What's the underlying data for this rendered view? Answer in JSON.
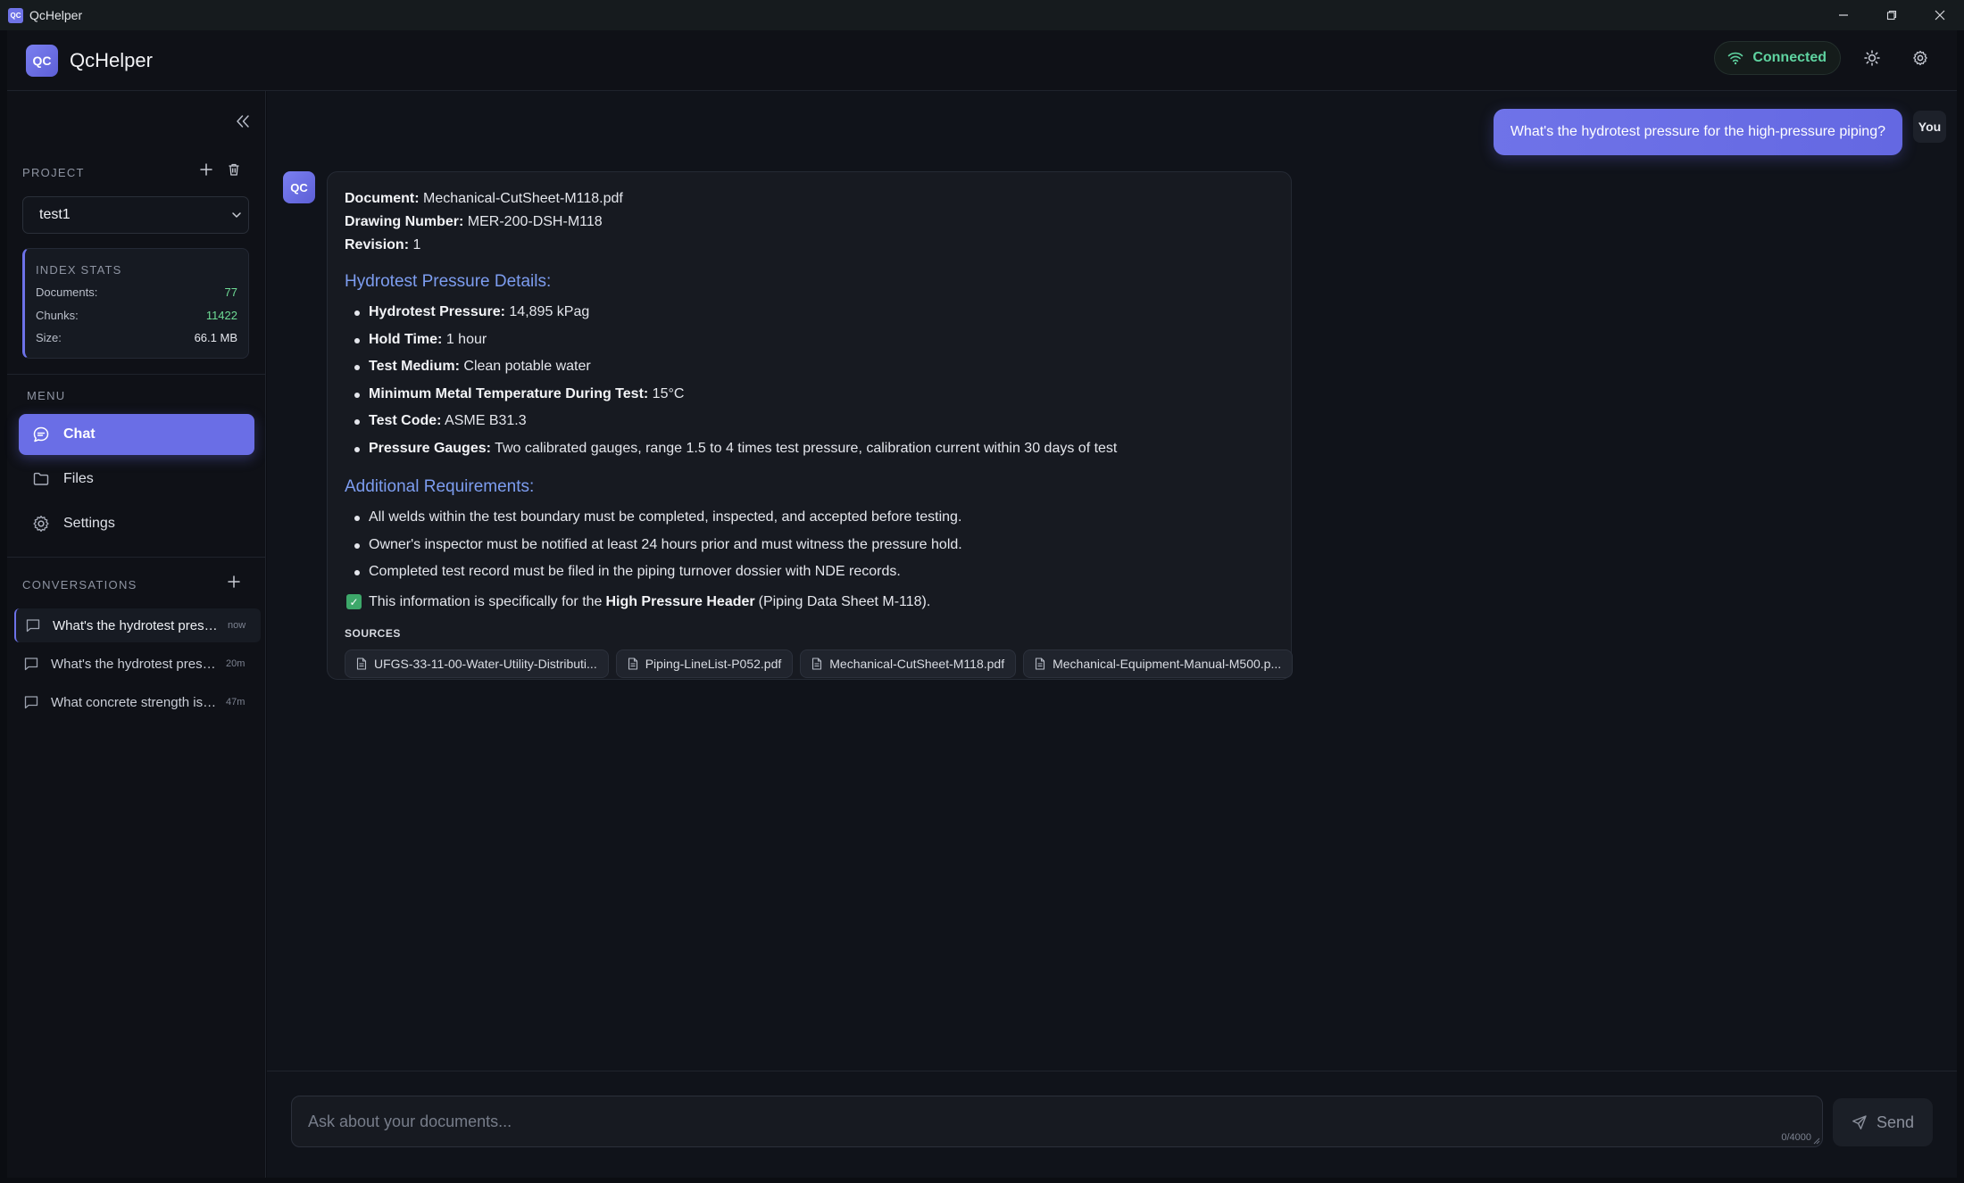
{
  "os": {
    "title": "QcHelper",
    "app_icon_text": "QC"
  },
  "header": {
    "brand": "QcHelper",
    "logo_text": "QC",
    "status": "Connected"
  },
  "sidebar": {
    "project_label": "PROJECT",
    "project_value": "test1",
    "stats": {
      "title": "INDEX STATS",
      "rows": [
        {
          "label": "Documents:",
          "value": "77"
        },
        {
          "label": "Chunks:",
          "value": "11422"
        },
        {
          "label": "Size:",
          "value": "66.1 MB"
        }
      ]
    },
    "menu_label": "MENU",
    "menu": [
      {
        "label": "Chat"
      },
      {
        "label": "Files"
      },
      {
        "label": "Settings"
      }
    ],
    "conversations_label": "CONVERSATIONS",
    "conversations": [
      {
        "title": "What's the hydrotest pressure for the high-pressure piping?",
        "time": "now"
      },
      {
        "title": "What's the hydrotest pressure for the high-pressure piping?",
        "time": "20m"
      },
      {
        "title": "What concrete strength is required?",
        "time": "47m"
      }
    ]
  },
  "chat": {
    "user_message": "What's the hydrotest pressure for the high-pressure piping?",
    "you_label": "You",
    "bot_avatar": "QC",
    "response": {
      "meta": [
        {
          "label": "Document:",
          "value": "Mechanical-CutSheet-M118.pdf"
        },
        {
          "label": "Drawing Number:",
          "value": "MER-200-DSH-M118"
        },
        {
          "label": "Revision:",
          "value": "1"
        }
      ],
      "section1_title": "Hydrotest Pressure Details:",
      "details": [
        {
          "label": "Hydrotest Pressure:",
          "value": "14,895 kPag"
        },
        {
          "label": "Hold Time:",
          "value": "1 hour"
        },
        {
          "label": "Test Medium:",
          "value": "Clean potable water"
        },
        {
          "label": "Minimum Metal Temperature During Test:",
          "value": "15°C"
        },
        {
          "label": "Test Code:",
          "value": "ASME B31.3"
        },
        {
          "label": "Pressure Gauges:",
          "value": "Two calibrated gauges, range 1.5 to 4 times test pressure, calibration current within 30 days of test"
        }
      ],
      "section2_title": "Additional Requirements:",
      "requirements": [
        "All welds within the test boundary must be completed, inspected, and accepted before testing.",
        "Owner's inspector must be notified at least 24 hours prior and must witness the pressure hold.",
        "Completed test record must be filed in the piping turnover dossier with NDE records."
      ],
      "note_prefix": "This information is specifically for the",
      "note_bold": "High Pressure Header",
      "note_suffix": "(Piping Data Sheet M-118).",
      "sources_label": "SOURCES",
      "sources": [
        "UFGS-33-11-00-Water-Utility-Distributi...",
        "Piping-LineList-P052.pdf",
        "Mechanical-CutSheet-M118.pdf",
        "Mechanical-Equipment-Manual-M500.p..."
      ]
    }
  },
  "composer": {
    "placeholder": "Ask about your documents...",
    "counter": "0/4000",
    "send_label": "Send"
  },
  "colors": {
    "accent": "#6a6ee6",
    "connected": "#5fd3a0",
    "section_heading": "#7d9df0",
    "stat_green": "#6fdc96",
    "check": "#3da86a"
  },
  "icons": [
    "wifi-icon",
    "sun-icon",
    "gear-icon",
    "collapse-chevrons-icon",
    "plus-icon",
    "trash-icon",
    "chevron-down-icon",
    "chat-bubble-icon",
    "folder-icon",
    "settings-gear-icon",
    "message-icon",
    "check-icon",
    "document-icon",
    "send-icon",
    "minimize-icon",
    "restore-icon",
    "close-icon"
  ]
}
